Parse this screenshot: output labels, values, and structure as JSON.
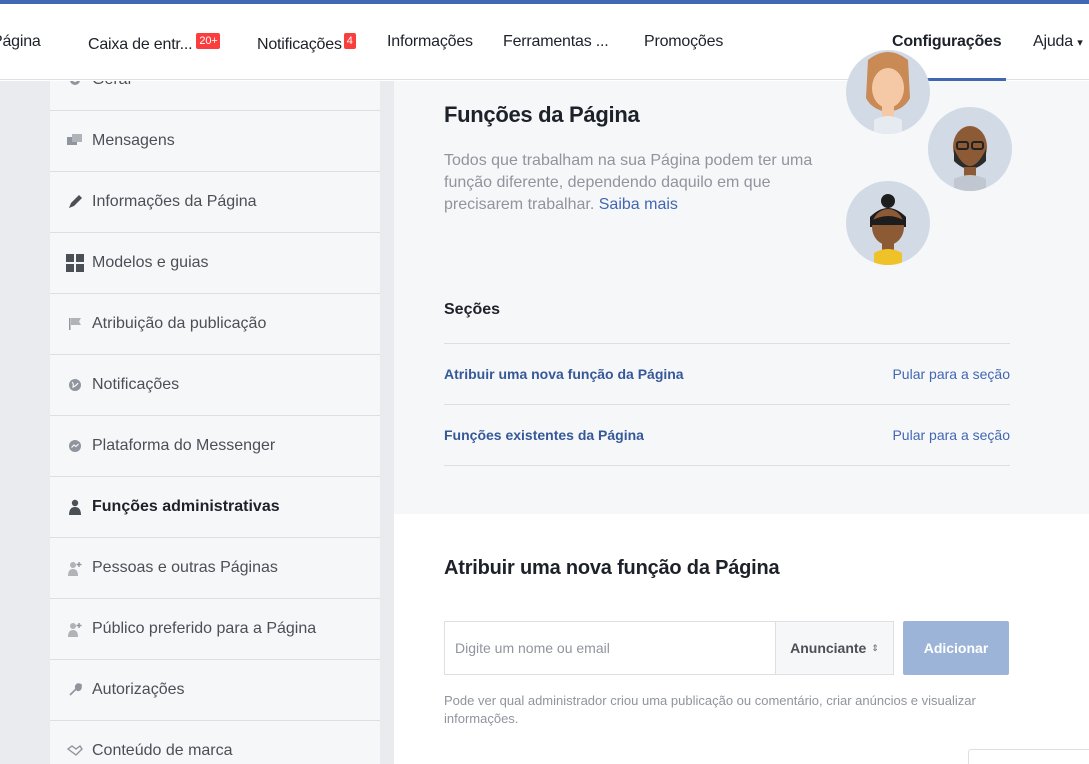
{
  "tabs": {
    "pagina": "Página",
    "inbox": "Caixa de entr...",
    "inbox_badge": "20+",
    "notifications": "Notificações",
    "notifications_badge": "4",
    "insights": "Informações",
    "tools": "Ferramentas ...",
    "promotions": "Promoções",
    "settings": "Configurações",
    "help": "Ajuda",
    "help_caret": "▾"
  },
  "sidebar": {
    "items": [
      {
        "label": "Geral",
        "icon": "gear-icon"
      },
      {
        "label": "Mensagens",
        "icon": "messages-icon"
      },
      {
        "label": "Informações da Página",
        "icon": "pencil-icon"
      },
      {
        "label": "Modelos e guias",
        "icon": "grid-icon"
      },
      {
        "label": "Atribuição da publicação",
        "icon": "flag-icon"
      },
      {
        "label": "Notificações",
        "icon": "globe-icon"
      },
      {
        "label": "Plataforma do Messenger",
        "icon": "messenger-icon"
      },
      {
        "label": "Funções administrativas",
        "icon": "person-icon",
        "active": true
      },
      {
        "label": "Pessoas e outras Páginas",
        "icon": "person-plus-icon"
      },
      {
        "label": "Público preferido para a Página",
        "icon": "person-plus-icon"
      },
      {
        "label": "Autorizações",
        "icon": "wrench-icon"
      },
      {
        "label": "Conteúdo de marca",
        "icon": "handshake-icon"
      }
    ]
  },
  "roles": {
    "title": "Funções da Página",
    "description": "Todos que trabalham na sua Página podem ter uma função diferente, dependendo daquilo em que precisarem trabalhar.",
    "learn_more": "Saiba mais"
  },
  "sections": {
    "title": "Seções",
    "rows": [
      {
        "label": "Atribuir uma nova função da Página",
        "jump": "Pular para a seção"
      },
      {
        "label": "Funções existentes da Página",
        "jump": "Pular para a seção"
      }
    ]
  },
  "assign": {
    "title": "Atribuir uma nova função da Página",
    "input_placeholder": "Digite um nome ou email",
    "role_selected": "Anunciante",
    "role_caret": "⇕",
    "add_button": "Adicionar",
    "help_text": "Pode ver qual administrador criou uma publicação ou comentário, criar anúncios e visualizar informações."
  },
  "colors": {
    "brand": "#4267b2",
    "badge": "#fa3e3e",
    "button_disabled": "#9cb4d8",
    "link": "#365899"
  }
}
